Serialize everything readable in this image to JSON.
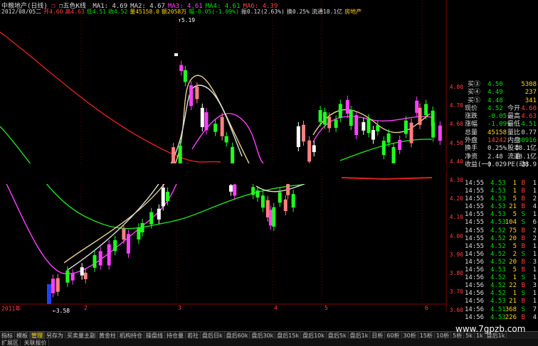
{
  "header": {
    "title": "中粮地产(日线)",
    "marker": "❐",
    "ind_label": "❒五色K线",
    "ma": [
      "MA1: 4.69",
      "MA2: 4.67",
      "MA3: 4.61",
      "MA4: 4.61",
      "MA6: 4.39"
    ],
    "ma_colors": [
      "#ddd",
      "#ddd",
      "#ff40ff",
      "#00e000",
      "#ff4040"
    ],
    "line2": [
      {
        "t": "2012/08/05二",
        "c": "w"
      },
      {
        "t": "开4.60",
        "c": "r"
      },
      {
        "t": "高4.63",
        "c": "r"
      },
      {
        "t": "低4.51",
        "c": "g"
      },
      {
        "t": "收4.52",
        "c": "g"
      },
      {
        "t": "量45158.0",
        "c": "y"
      },
      {
        "t": "额2058万",
        "c": "y"
      },
      {
        "t": "幅-0.05(-1.09%)",
        "c": "g"
      },
      {
        "t": "振0.12(2.63%)",
        "c": "w"
      },
      {
        "t": "换0.25%",
        "c": "w"
      },
      {
        "t": "流通18.1亿",
        "c": "w"
      },
      {
        "t": "房地产",
        "c": "y"
      }
    ]
  },
  "annotations": {
    "high": "5.19",
    "low": "3.58"
  },
  "y_ticks": [
    "4.80",
    "4.70",
    "4.60",
    "4.50",
    "4.40",
    "4.30",
    "4.20",
    "4.10",
    "4.00",
    "3.90",
    "3.80",
    "3.70",
    "3.60"
  ],
  "x_ticks": [
    "2011年",
    "2",
    "3",
    "4",
    "5",
    "6"
  ],
  "order_book": [
    {
      "label": "买③",
      "price": "4.50",
      "vol": "5308"
    },
    {
      "label": "买④",
      "price": "4.49",
      "vol": "237"
    },
    {
      "label": "买⑤",
      "price": "4.48",
      "vol": "341"
    }
  ],
  "stats": [
    {
      "l1": "现价",
      "v1": "4.52",
      "c1": "#00e000",
      "l2": "今开",
      "v2": "4.60",
      "c2": "#ff4040"
    },
    {
      "l1": "涨跌",
      "v1": "-0.05",
      "c1": "#00e000",
      "l2": "最高",
      "v2": "4.63",
      "c2": "#ff4040"
    },
    {
      "l1": "涨幅",
      "v1": "-1.09%",
      "c1": "#00e000",
      "l2": "最低",
      "v2": "4.51",
      "c2": "#00e000"
    },
    {
      "l1": "总量",
      "v1": "45158",
      "c1": "#ffd700",
      "l2": "量比",
      "v2": "0.77",
      "c2": "#ddd"
    },
    {
      "l1": "外盘",
      "v1": "14242",
      "c1": "#ff4040",
      "l2": "内盘",
      "v2": "30916",
      "c2": "#00e000"
    },
    {
      "l1": "换手",
      "v1": "0.25%",
      "c1": "#ddd",
      "l2": "股本",
      "v2": "18.1亿",
      "c2": "#ddd"
    },
    {
      "l1": "净资",
      "v1": "2.48",
      "c1": "#ddd",
      "l2": "流通",
      "v2": "18.1亿",
      "c2": "#ddd"
    },
    {
      "l1": "收益(一)",
      "v1": "0.029",
      "c1": "#ddd",
      "l2": "PE(动)",
      "v2": "38.9",
      "c2": "#ddd"
    }
  ],
  "ticks": [
    {
      "t": "14:55",
      "p": "4.53",
      "v": "1",
      "s": "B",
      "n": "1"
    },
    {
      "t": "14:55",
      "p": "4.53",
      "v": "1",
      "s": "B",
      "n": "1"
    },
    {
      "t": "14:55",
      "p": "4.53",
      "v": "5",
      "s": "B",
      "n": "2"
    },
    {
      "t": "14:55",
      "p": "4.53",
      "v": "21",
      "s": "B",
      "n": "4"
    },
    {
      "t": "14:55",
      "p": "4.53",
      "v": "5",
      "s": "S",
      "n": "1"
    },
    {
      "t": "14:55",
      "p": "4.53",
      "v": "104",
      "s": "S",
      "n": "6"
    },
    {
      "t": "14:55",
      "p": "4.52",
      "v": "75",
      "s": "B",
      "n": "2"
    },
    {
      "t": "14:55",
      "p": "4.52",
      "v": "20",
      "s": "B",
      "n": "2"
    },
    {
      "t": "14:55",
      "p": "4.52",
      "v": "5",
      "s": "B",
      "n": "1"
    },
    {
      "t": "14:56",
      "p": "4.52",
      "v": "2",
      "s": "S",
      "n": "1"
    },
    {
      "t": "14:56",
      "p": "4.52",
      "v": "20",
      "s": "B",
      "n": "3"
    },
    {
      "t": "14:56",
      "p": "4.53",
      "v": "5",
      "s": "B",
      "n": "1"
    },
    {
      "t": "14:56",
      "p": "4.52",
      "v": "1",
      "s": "S",
      "n": "1"
    },
    {
      "t": "14:56",
      "p": "4.52",
      "v": "22",
      "s": "B",
      "n": "3"
    },
    {
      "t": "14:56",
      "p": "4.52",
      "v": "1",
      "s": "S",
      "n": "1"
    },
    {
      "t": "14:56",
      "p": "4.53",
      "v": "21",
      "s": "B",
      "n": "1"
    },
    {
      "t": "14:56",
      "p": "4.51",
      "v": "368",
      "s": "S",
      "n": "7"
    },
    {
      "t": "14:56",
      "p": "4.53",
      "v": "226",
      "s": "B",
      "n": "4"
    }
  ],
  "tabs": [
    "指标",
    "模板",
    "管理",
    "另存为",
    "买卖量主副",
    "黄金柱",
    "机构持仓",
    "操盘线",
    "持仓量",
    "若社",
    "盘后日k",
    "盘后60k",
    "盘后30k",
    "盘后15k",
    "盘后10k",
    "盘后5k",
    "盘后1k",
    "日析",
    "60析",
    "30析",
    "15析",
    "10析",
    "5析",
    "5k",
    "1k",
    "盘后1k"
  ],
  "active_tab": 2,
  "status": [
    "扩展区",
    "关联报价"
  ],
  "watermark": "www.7gpzb.com"
}
